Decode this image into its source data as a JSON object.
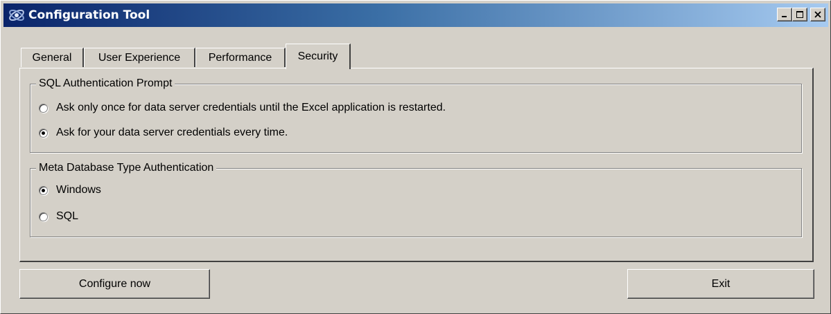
{
  "window": {
    "title": "Configuration Tool",
    "controls": {
      "minimize": "minimize-icon",
      "maximize": "maximize-icon",
      "close": "close-icon"
    }
  },
  "tabs": [
    {
      "label": "General",
      "active": false
    },
    {
      "label": "User Experience",
      "active": false
    },
    {
      "label": "Performance",
      "active": false
    },
    {
      "label": "Security",
      "active": true
    }
  ],
  "security": {
    "sql_auth": {
      "legend": "SQL Authentication Prompt",
      "options": [
        {
          "label": "Ask only once for data server credentials until the Excel application is restarted.",
          "checked": false
        },
        {
          "label": "Ask for your data server credentials every time.",
          "checked": true
        }
      ]
    },
    "meta_auth": {
      "legend": "Meta Database Type Authentication",
      "options": [
        {
          "label": "Windows",
          "checked": true
        },
        {
          "label": "SQL",
          "checked": false
        }
      ]
    }
  },
  "buttons": {
    "configure_label": "Configure now",
    "exit_label": "Exit"
  }
}
